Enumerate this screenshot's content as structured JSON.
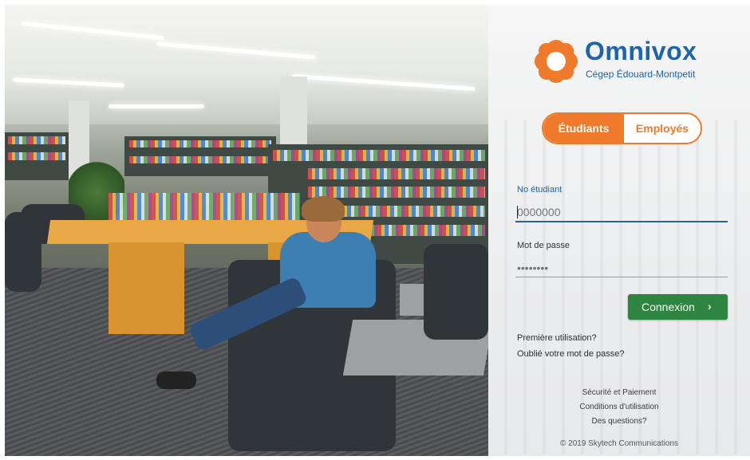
{
  "brand": {
    "name": "Omnivox",
    "subtitle": "Cégep Édouard-Montpetit",
    "accent_color": "#f07a2b",
    "brand_color": "#1f63a8"
  },
  "toggle": {
    "active_label": "Étudiants",
    "inactive_label": "Employés"
  },
  "form": {
    "id_label": "No étudiant",
    "id_placeholder": "0000000",
    "password_label": "Mot de passe",
    "password_placeholder": "••••••••",
    "submit_label": "Connexion",
    "submit_icon": "chevron-right-icon",
    "submit_color": "#2e8540"
  },
  "links": {
    "first_use": "Première utilisation?",
    "forgot_password": "Oublié votre mot de passe?"
  },
  "footer": {
    "security": "Sécurité et Paiement",
    "terms": "Conditions d'utilisation",
    "questions": "Des questions?",
    "copyright": "© 2019 Skytech Communications"
  }
}
